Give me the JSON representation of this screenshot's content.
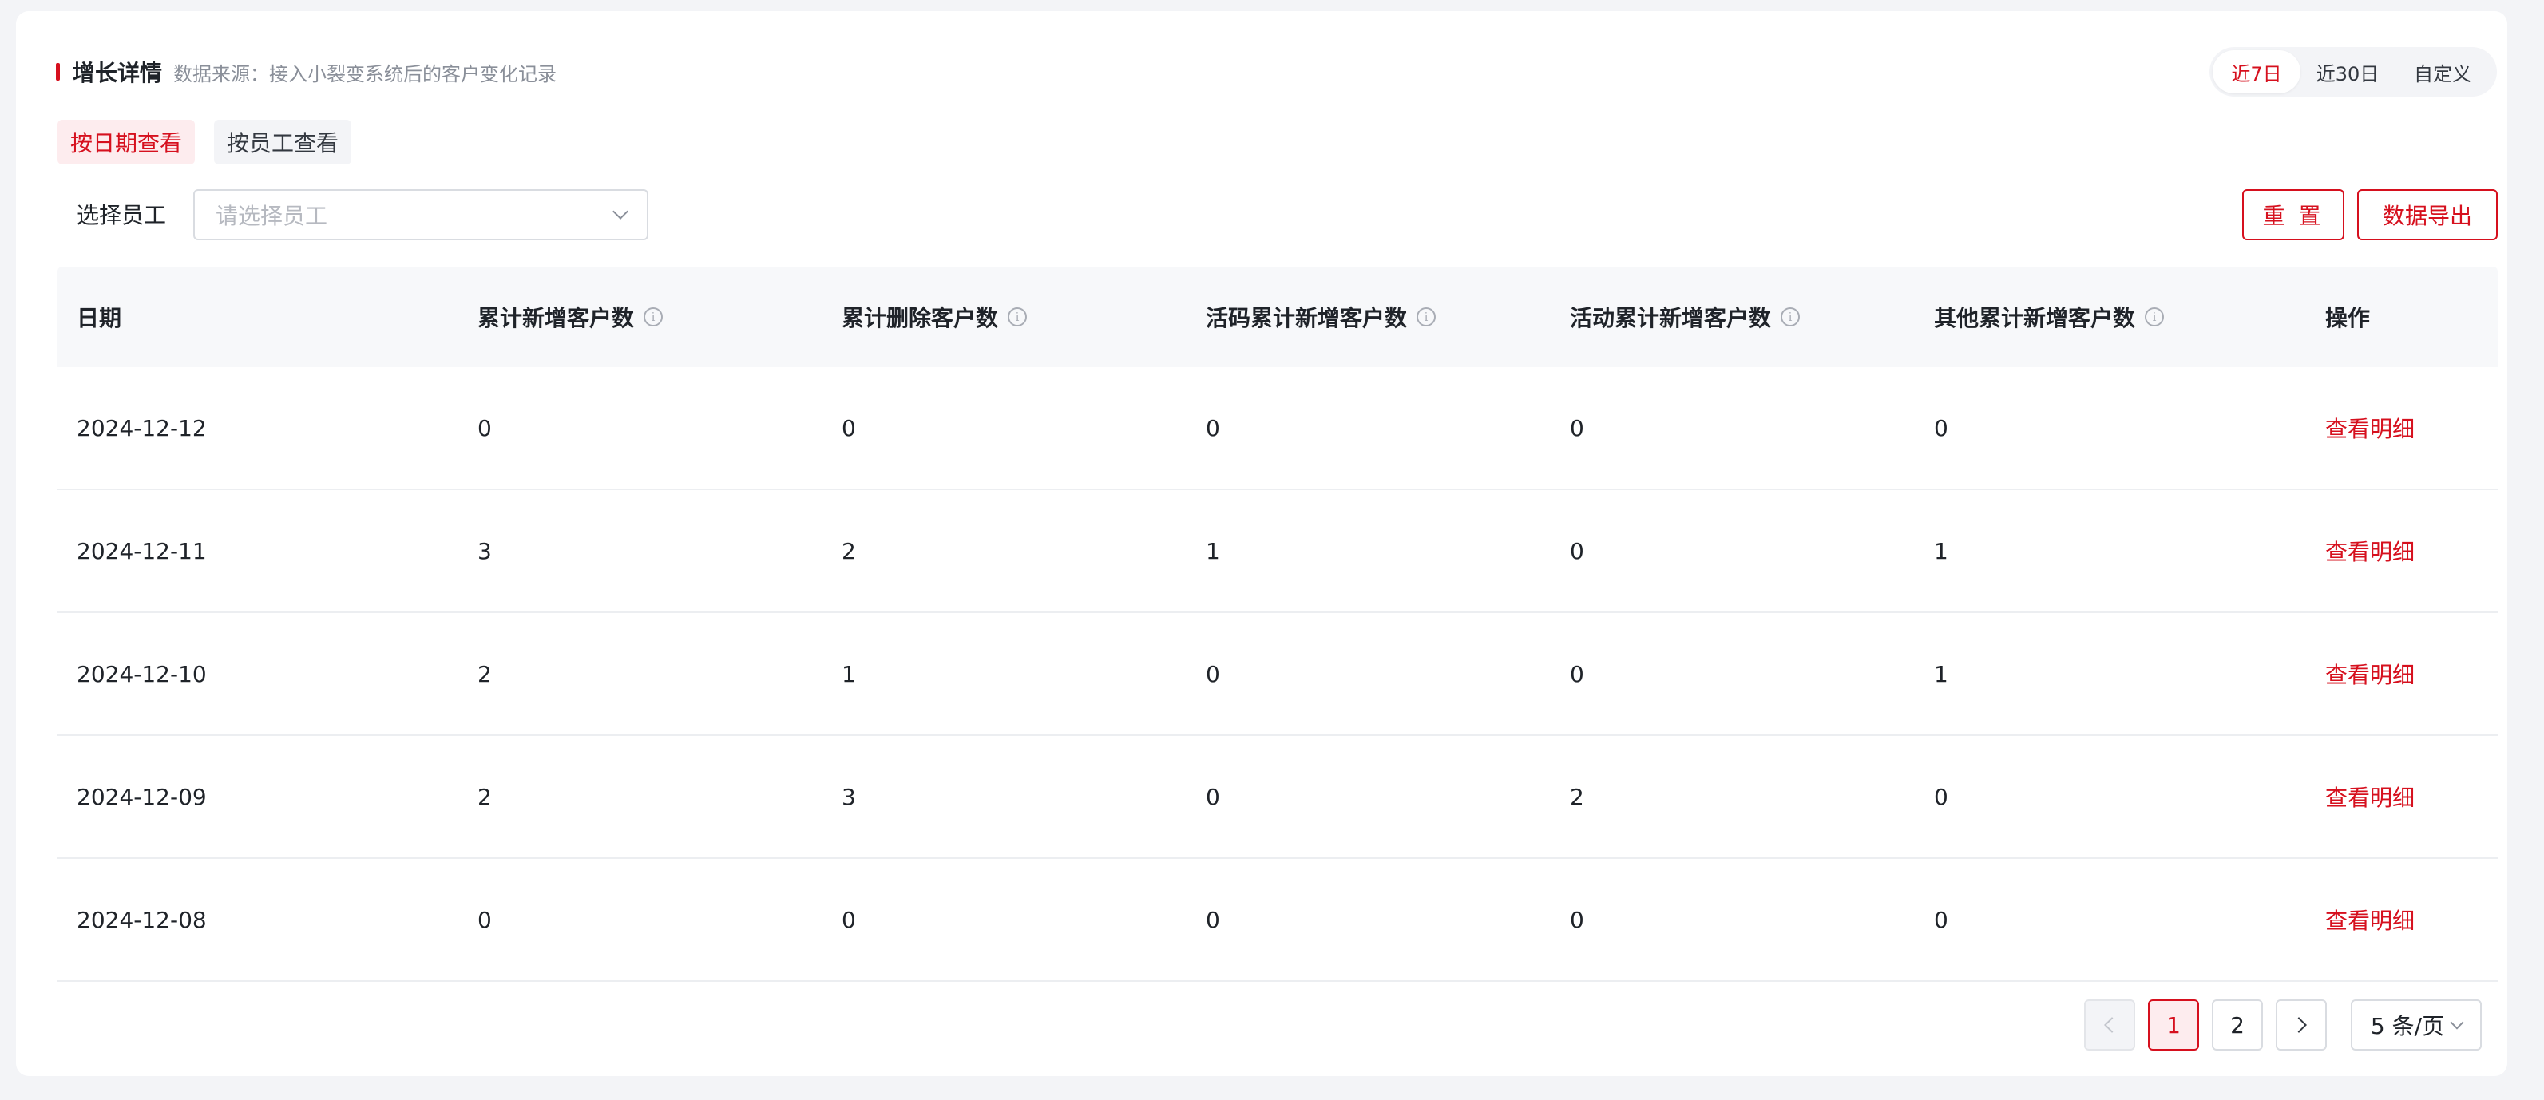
{
  "header": {
    "title": "增长详情",
    "subtitle": "数据来源：接入小裂变系统后的客户变化记录"
  },
  "range": {
    "options": [
      "近7日",
      "近30日",
      "自定义"
    ],
    "selected": "近7日"
  },
  "view_tabs": [
    {
      "label": "按日期查看",
      "active": true
    },
    {
      "label": "按员工查看",
      "active": false
    }
  ],
  "filter": {
    "label": "选择员工",
    "placeholder": "请选择员工"
  },
  "actions": {
    "reset": "重 置",
    "export": "数据导出"
  },
  "table": {
    "columns": [
      "日期",
      "累计新增客户数",
      "累计删除客户数",
      "活码累计新增客户数",
      "活动累计新增客户数",
      "其他累计新增客户数",
      "操作"
    ],
    "rows": [
      {
        "date": "2024-12-12",
        "added": "0",
        "deleted": "0",
        "qrcode": "0",
        "activity": "0",
        "other": "0",
        "action": "查看明细"
      },
      {
        "date": "2024-12-11",
        "added": "3",
        "deleted": "2",
        "qrcode": "1",
        "activity": "0",
        "other": "1",
        "action": "查看明细"
      },
      {
        "date": "2024-12-10",
        "added": "2",
        "deleted": "1",
        "qrcode": "0",
        "activity": "0",
        "other": "1",
        "action": "查看明细"
      },
      {
        "date": "2024-12-09",
        "added": "2",
        "deleted": "3",
        "qrcode": "0",
        "activity": "2",
        "other": "0",
        "action": "查看明细"
      },
      {
        "date": "2024-12-08",
        "added": "0",
        "deleted": "0",
        "qrcode": "0",
        "activity": "0",
        "other": "0",
        "action": "查看明细"
      }
    ]
  },
  "pagination": {
    "pages": [
      "1",
      "2"
    ],
    "current": "1",
    "page_size": "5 条/页"
  },
  "colors": {
    "accent": "#d6101e",
    "accent_light": "#fdecee",
    "background": "#f3f4f7"
  },
  "icons": {
    "info": "info-circle-icon",
    "dropdown": "chevron-down-icon",
    "prev": "chevron-left-icon",
    "next": "chevron-right-icon"
  }
}
